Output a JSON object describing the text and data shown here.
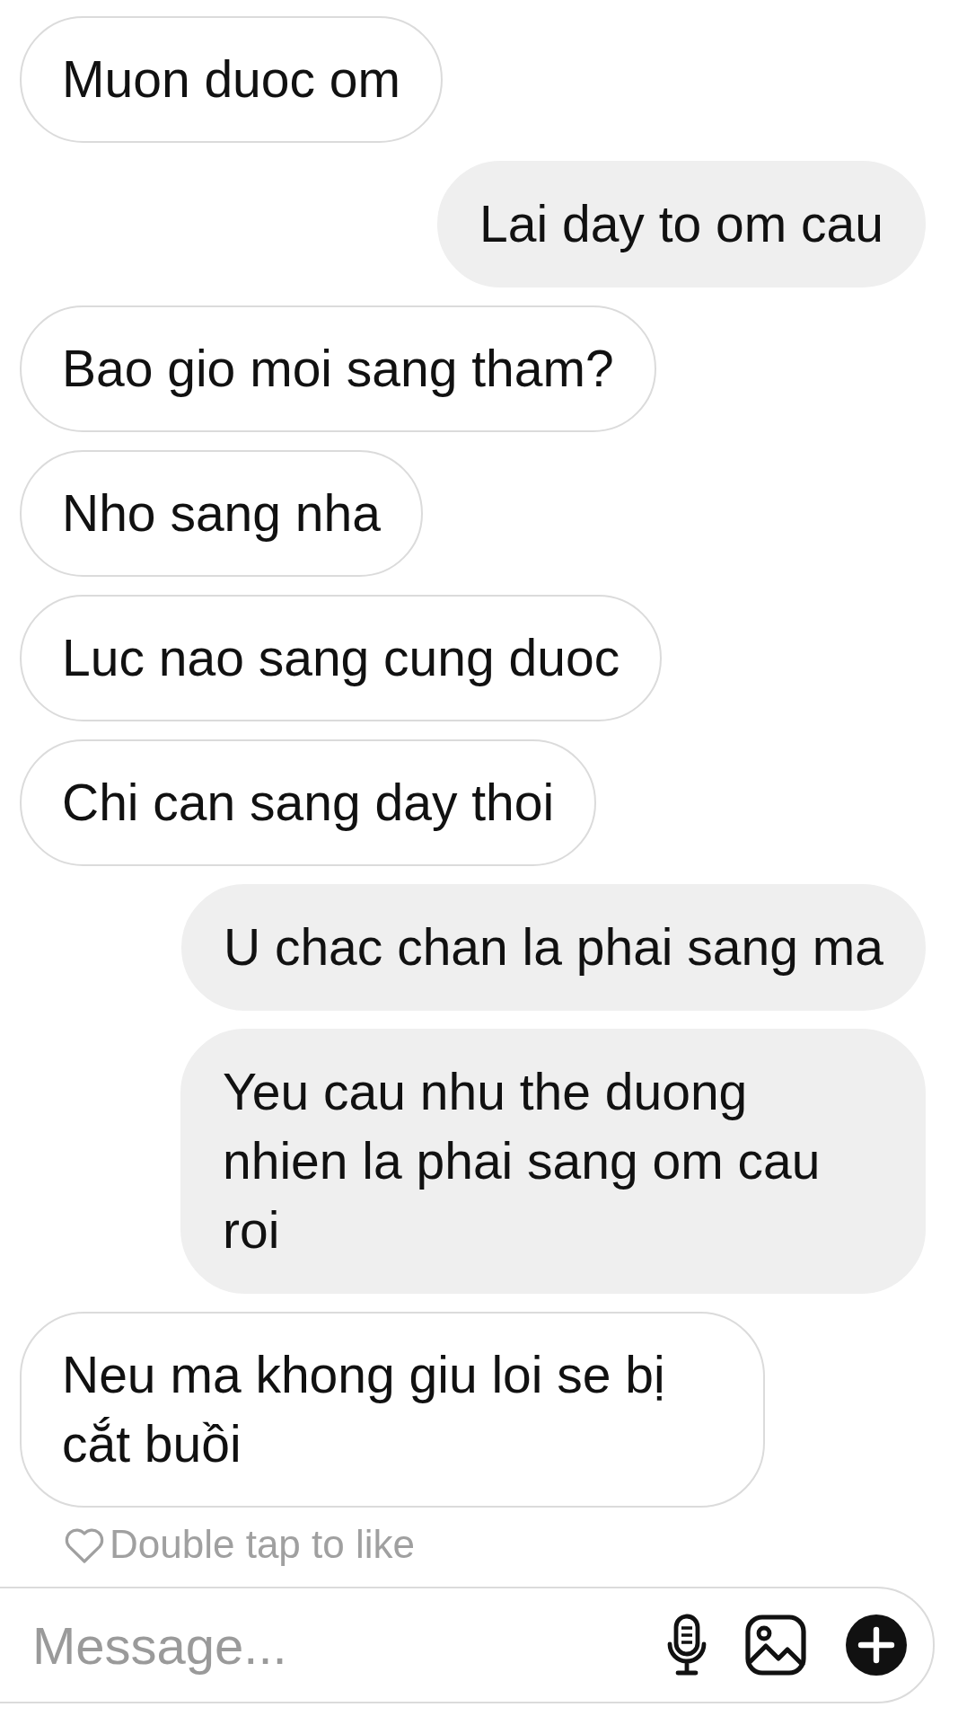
{
  "messages": [
    {
      "text": "Muon duoc om",
      "sent": false
    },
    {
      "text": "Lai day to om cau",
      "sent": true
    },
    {
      "text": "Bao gio moi sang tham?",
      "sent": false
    },
    {
      "text": "Nho sang nha",
      "sent": false
    },
    {
      "text": "Luc nao sang cung duoc",
      "sent": false
    },
    {
      "text": "Chi can sang day thoi",
      "sent": false
    },
    {
      "text": "U chac chan la phai sang ma",
      "sent": true
    },
    {
      "text": "Yeu cau nhu the duong nhien la phai sang om cau roi",
      "sent": true
    },
    {
      "text": "Neu ma khong giu loi se bị cắt buồi",
      "sent": false
    }
  ],
  "like_hint": "Double tap to like",
  "composer": {
    "placeholder": "Message..."
  }
}
